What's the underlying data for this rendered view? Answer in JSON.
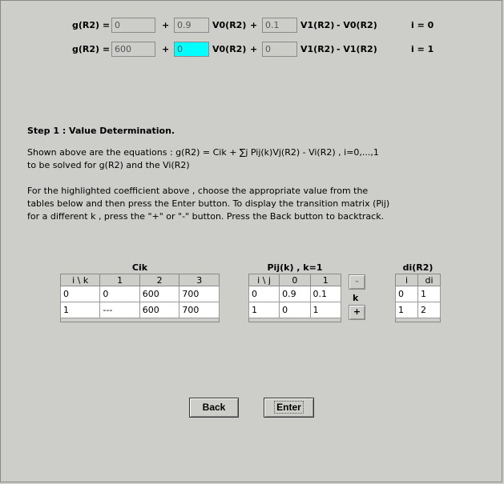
{
  "equations": [
    {
      "lhs": "g(R2) =",
      "cik_value": "0",
      "plus1": "+",
      "p0_value": "0.9",
      "v0_label": "V0(R2)",
      "plus2": "+",
      "p1_value": "0.1",
      "v1_label": "V1(R2)",
      "minus_term": "-  V0(R2)",
      "index_label": "i = 0"
    },
    {
      "lhs": "g(R2) =",
      "cik_value": "600",
      "plus1": "+",
      "p0_value": "0",
      "v0_label": "V0(R2)",
      "plus2": "+",
      "p1_value": "0",
      "v1_label": "V1(R2)",
      "minus_term": "-  V1(R2)",
      "index_label": "i = 1"
    }
  ],
  "highlight_color": "#00ffff",
  "step_title": "Step 1 :  Value Determination.",
  "desc_lines": [
    "Shown above are the equations : g(R2) = Cik + ∑j Pij(k)Vj(R2) - Vi(R2) , i=0,...,1",
    "to be solved for g(R2) and the Vi(R2)"
  ],
  "instr_lines": [
    "For the highlighted coefficient above , choose the appropriate value from the",
    "tables below and then press the Enter button. To display the transition matrix (Pij)",
    "for a different k , press the \"+\" or \"-\" button. Press the Back button to backtrack."
  ],
  "cik_table": {
    "title": "Cik",
    "headers": [
      "i \\ k",
      "1",
      "2",
      "3"
    ],
    "rows": [
      [
        "0",
        "0",
        "600",
        "700"
      ],
      [
        "1",
        "---",
        "600",
        "700"
      ]
    ]
  },
  "pij_table": {
    "title": "Pij(k) , k=1",
    "headers": [
      "i \\ j",
      "0",
      "1"
    ],
    "rows": [
      [
        "0",
        "0.9",
        "0.1"
      ],
      [
        "1",
        "0",
        "1"
      ]
    ]
  },
  "k_controls": {
    "minus": "-",
    "label": "k",
    "plus": "+"
  },
  "di_table": {
    "title": "di(R2)",
    "headers": [
      "i",
      "di"
    ],
    "rows": [
      [
        "0",
        "1"
      ],
      [
        "1",
        "2"
      ]
    ]
  },
  "buttons": {
    "back": "Back",
    "enter": "Enter"
  }
}
